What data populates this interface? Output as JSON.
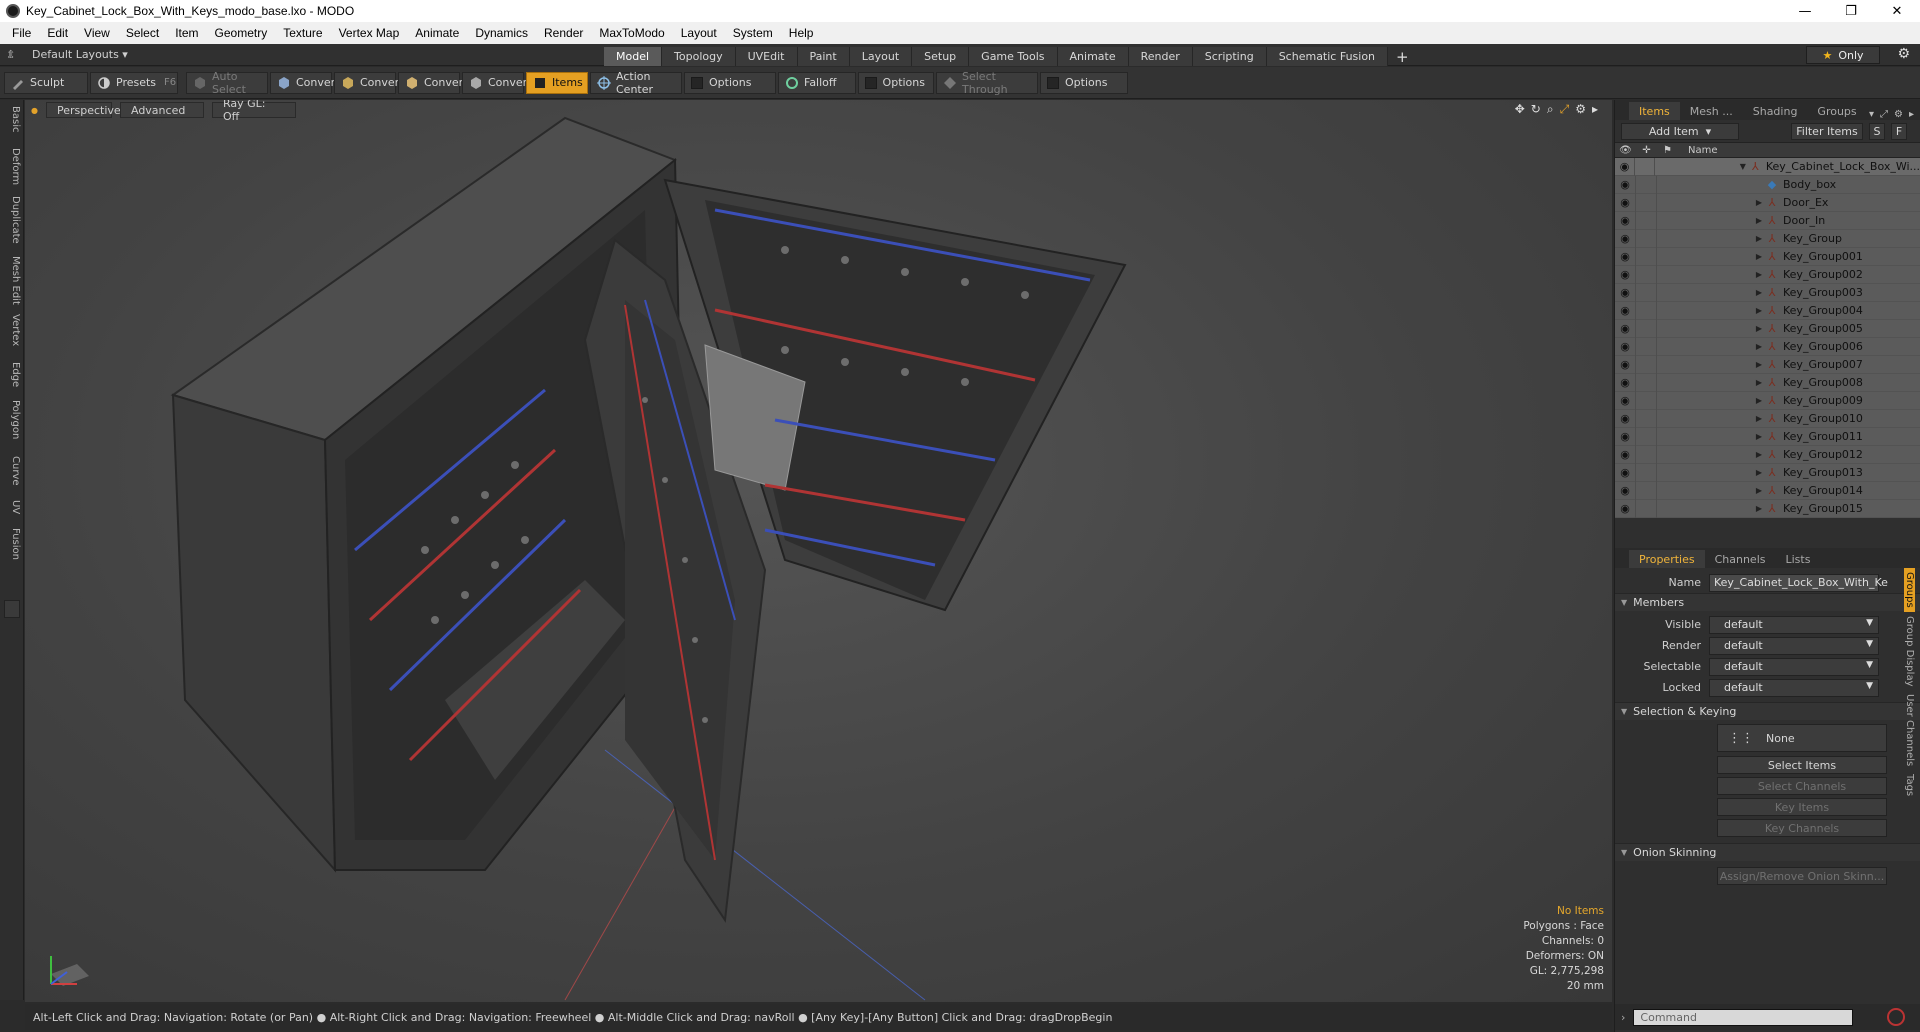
{
  "window": {
    "title": "Key_Cabinet_Lock_Box_With_Keys_modo_base.lxo - MODO",
    "minimize": "—",
    "maximize": "❐",
    "close": "✕"
  },
  "menu": [
    "File",
    "Edit",
    "View",
    "Select",
    "Item",
    "Geometry",
    "Texture",
    "Vertex Map",
    "Animate",
    "Dynamics",
    "Render",
    "MaxToModo",
    "Layout",
    "System",
    "Help"
  ],
  "layout_selector": "Default Layouts ▾",
  "layout_tabs": [
    {
      "label": "Model",
      "active": true
    },
    {
      "label": "Topology",
      "active": false
    },
    {
      "label": "UVEdit",
      "active": false
    },
    {
      "label": "Paint",
      "active": false
    },
    {
      "label": "Layout",
      "active": false
    },
    {
      "label": "Setup",
      "active": false
    },
    {
      "label": "Game Tools",
      "active": false
    },
    {
      "label": "Animate",
      "active": false
    },
    {
      "label": "Render",
      "active": false
    },
    {
      "label": "Scripting",
      "active": false
    },
    {
      "label": "Schematic Fusion",
      "active": false
    }
  ],
  "only_label": "Only",
  "toolbar": {
    "sculpt": "Sculpt",
    "presets": "Presets",
    "presets_key": "F6",
    "auto_select": "Auto Select",
    "convert1": "Convert",
    "convert2": "Convert",
    "convert3": "Convert",
    "convert4": "Convert",
    "items": "Items",
    "action_center": "Action Center",
    "options1": "Options",
    "falloff": "Falloff",
    "options2": "Options",
    "select_through": "Select Through",
    "options3": "Options"
  },
  "left_tabs": [
    "Basic",
    "Deform",
    "Duplicate",
    "Mesh Edit",
    "Vertex",
    "Edge",
    "Polygon",
    "Curve",
    "UV",
    "Fusion"
  ],
  "viewport": {
    "perspective": "Perspective",
    "advanced": "Advanced",
    "raygl": "Ray GL: Off",
    "stats": {
      "no_items": "No Items",
      "polygons": "Polygons : Face",
      "channels": "Channels: 0",
      "deformers": "Deformers: ON",
      "gl": "GL: 2,775,298",
      "scale": "20 mm"
    }
  },
  "status_text": "Alt-Left Click and Drag: Navigation: Rotate (or Pan) ● Alt-Right Click and Drag: Navigation: Freewheel ● Alt-Middle Click and Drag: navRoll ● [Any Key]-[Any Button] Click and Drag: dragDropBegin",
  "panel": {
    "tabs": [
      "Items",
      "Mesh ...",
      "Shading",
      "Groups"
    ],
    "add_item": "Add Item",
    "filter_items": "Filter Items",
    "s_btn": "S",
    "f_btn": "F",
    "name_col": "Name",
    "tree": [
      {
        "label": "Key_Cabinet_Lock_Box_Wi...",
        "type": "group",
        "depth": 0,
        "arrow": "▼"
      },
      {
        "label": "Body_box",
        "type": "mesh",
        "depth": 1,
        "arrow": ""
      },
      {
        "label": "Door_Ex",
        "type": "group",
        "depth": 1,
        "arrow": "▶"
      },
      {
        "label": "Door_In",
        "type": "group",
        "depth": 1,
        "arrow": "▶"
      },
      {
        "label": "Key_Group",
        "type": "group",
        "depth": 1,
        "arrow": "▶"
      },
      {
        "label": "Key_Group001",
        "type": "group",
        "depth": 1,
        "arrow": "▶"
      },
      {
        "label": "Key_Group002",
        "type": "group",
        "depth": 1,
        "arrow": "▶"
      },
      {
        "label": "Key_Group003",
        "type": "group",
        "depth": 1,
        "arrow": "▶"
      },
      {
        "label": "Key_Group004",
        "type": "group",
        "depth": 1,
        "arrow": "▶"
      },
      {
        "label": "Key_Group005",
        "type": "group",
        "depth": 1,
        "arrow": "▶"
      },
      {
        "label": "Key_Group006",
        "type": "group",
        "depth": 1,
        "arrow": "▶"
      },
      {
        "label": "Key_Group007",
        "type": "group",
        "depth": 1,
        "arrow": "▶"
      },
      {
        "label": "Key_Group008",
        "type": "group",
        "depth": 1,
        "arrow": "▶"
      },
      {
        "label": "Key_Group009",
        "type": "group",
        "depth": 1,
        "arrow": "▶"
      },
      {
        "label": "Key_Group010",
        "type": "group",
        "depth": 1,
        "arrow": "▶"
      },
      {
        "label": "Key_Group011",
        "type": "group",
        "depth": 1,
        "arrow": "▶"
      },
      {
        "label": "Key_Group012",
        "type": "group",
        "depth": 1,
        "arrow": "▶"
      },
      {
        "label": "Key_Group013",
        "type": "group",
        "depth": 1,
        "arrow": "▶"
      },
      {
        "label": "Key_Group014",
        "type": "group",
        "depth": 1,
        "arrow": "▶"
      },
      {
        "label": "Key_Group015",
        "type": "group",
        "depth": 1,
        "arrow": "▶"
      }
    ],
    "prop_tabs": [
      "Properties",
      "Channels",
      "Lists"
    ],
    "name_label": "Name",
    "name_value": "Key_Cabinet_Lock_Box_With_Ke",
    "members": "Members",
    "visible_label": "Visible",
    "visible_value": "default",
    "render_label": "Render",
    "render_value": "default",
    "selectable_label": "Selectable",
    "selectable_value": "default",
    "locked_label": "Locked",
    "locked_value": "default",
    "selection_keying": "Selection & Keying",
    "none_label": "None",
    "select_items": "Select Items",
    "select_channels": "Select Channels",
    "key_items": "Key Items",
    "key_channels": "Key Channels",
    "onion_skinning": "Onion Skinning",
    "assign_remove": "Assign/Remove Onion Skinn...",
    "side_tabs": [
      "Groups",
      "Group Display",
      "User Channels",
      "Tags"
    ],
    "command_placeholder": "Command"
  },
  "colors": {
    "accent": "#e5a022",
    "tree_bg": "#5b5b5b",
    "viewport_bg": "#444444"
  }
}
